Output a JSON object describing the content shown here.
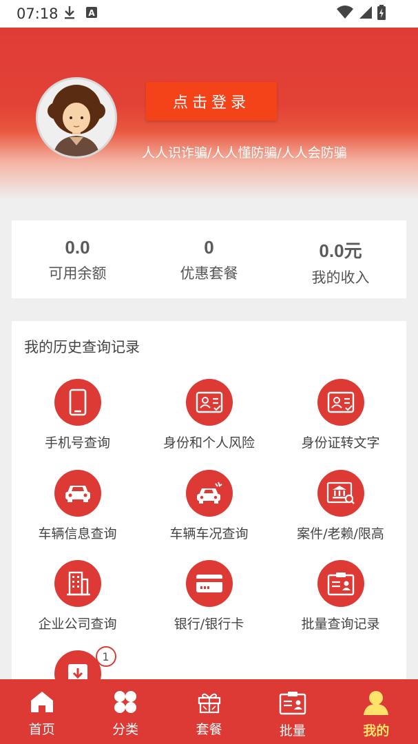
{
  "status_bar": {
    "time": "07:18",
    "left_icons": [
      "download-icon",
      "text-icon"
    ],
    "right_icons": [
      "wifi-icon",
      "signal-icon",
      "battery-icon"
    ]
  },
  "header": {
    "login_label": "点击登录",
    "slogan": "人人识诈骗/人人懂防骗/人人会防骗",
    "accent": "#e03c36"
  },
  "stats": [
    {
      "value": "0.0",
      "label": "可用余额"
    },
    {
      "value": "0",
      "label": "优惠套餐"
    },
    {
      "value": "0.0元",
      "label": "我的收入"
    }
  ],
  "history": {
    "title": "我的历史查询记录",
    "items": [
      {
        "label": "手机号查询",
        "icon": "phone-icon"
      },
      {
        "label": "身份和个人风险",
        "icon": "id-card-icon"
      },
      {
        "label": "身份证转文字",
        "icon": "id-card-icon"
      },
      {
        "label": "车辆信息查询",
        "icon": "car-icon"
      },
      {
        "label": "车辆车况查询",
        "icon": "car-accident-icon"
      },
      {
        "label": "案件/老赖/限高",
        "icon": "court-icon"
      },
      {
        "label": "企业公司查询",
        "icon": "building-icon"
      },
      {
        "label": "银行/银行卡",
        "icon": "bank-card-icon"
      },
      {
        "label": "批量查询记录",
        "icon": "badge-card-icon"
      },
      {
        "label": "",
        "icon": "download-box-icon",
        "badge": "1"
      }
    ]
  },
  "bottom_nav": [
    {
      "label": "首页",
      "icon": "home-icon"
    },
    {
      "label": "分类",
      "icon": "category-icon"
    },
    {
      "label": "套餐",
      "icon": "gift-icon"
    },
    {
      "label": "批量",
      "icon": "batch-icon"
    },
    {
      "label": "我的",
      "icon": "user-icon",
      "active": true
    }
  ],
  "colors": {
    "brand_red": "#dd3a35",
    "login_orange": "#f44219",
    "active_tab": "#ffe26a"
  }
}
